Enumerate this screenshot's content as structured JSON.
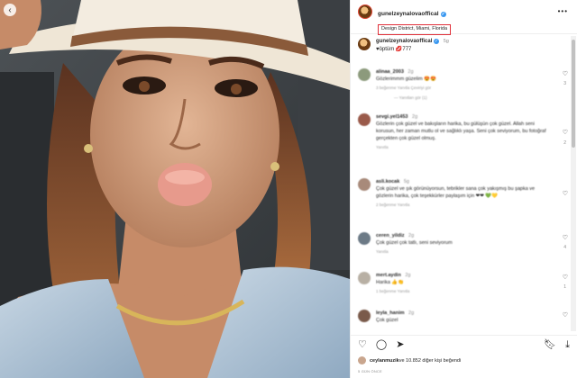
{
  "post": {
    "username": "gunelzeynalovaoffical",
    "location": "Design District, Miami, Florida",
    "caption_user": "gunelzeynalovaoffical",
    "caption_time": "5g",
    "caption_text": "♥öptüm 💋777",
    "more_label": "•••"
  },
  "comments": [
    {
      "user": "alinaa_2003",
      "time": "2g",
      "text": "Gözlerimmm güzelim 😍😍",
      "meta": "3 beğenme   Yanıtla   Çeviriyi gör",
      "likes": "3",
      "reply": "— Yanıtları gör (1)"
    },
    {
      "user": "sevgi.yel1453",
      "time": "2g",
      "text": "Gözlerin çok güzel ve bakışların harika, bu gülüşün çok güzel. Allah seni korusun, her zaman mutlu ol ve sağlıklı yaşa. Seni çok seviyorum, bu fotoğraf gerçekten çok güzel olmuş.",
      "meta": "Yanıtla",
      "likes": "2",
      "reply": ""
    },
    {
      "user": "asli.kocak",
      "time": "5g",
      "text": "Çok güzel ve şık görünüyorsun, tebrikler sana çok yakışmış bu şapka ve gözlerin harika, çok teşekkürler paylaşım için ❤❤ 💚💛",
      "meta": "2 beğenme   Yanıtla",
      "likes": "",
      "reply": ""
    },
    {
      "user": "ceren_yildiz",
      "time": "2g",
      "text": "Çok güzel çok tatlı, seni seviyorum",
      "meta": "Yanıtla",
      "likes": "4",
      "reply": ""
    },
    {
      "user": "mert.aydin",
      "time": "2g",
      "text": "Harika 👍👏",
      "meta": "1 beğenme   Yanıtla",
      "likes": "1",
      "reply": ""
    },
    {
      "user": "leyla_hanim",
      "time": "2g",
      "text": "Çok güzel",
      "meta": "",
      "likes": "",
      "reply": ""
    }
  ],
  "likes": {
    "liker": "ceylanmuzik",
    "text": " ve 10.852 diğer kişi beğendi"
  },
  "date": "5 GÜN ÖNCE",
  "icons": {
    "heart": "heart-icon",
    "comment": "comment-icon",
    "share": "share-icon",
    "save": "bookmark-icon",
    "download": "download-icon"
  },
  "colors": {
    "location_highlight": "#e0303a",
    "verified": "#3897f0"
  }
}
